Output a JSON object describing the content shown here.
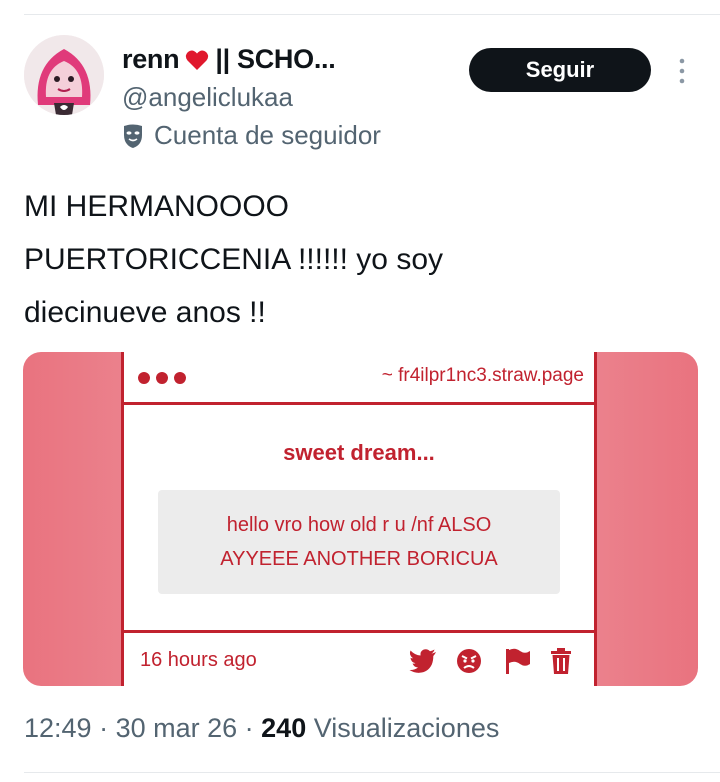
{
  "user": {
    "name": "renn",
    "name_suffix": "|| SCHO...",
    "handle": "@angeliclukaa",
    "follower_label": "Cuenta de seguidor",
    "follow_label": "Seguir"
  },
  "tweet": {
    "text": "MI HERMANOOOO\nPUERTORICCENIA !!!!!! yo soy\ndiecinueve anos !!"
  },
  "card": {
    "url": "~ fr4ilpr1nc3.straw.page",
    "headline": "sweet dream...",
    "message_line1": "hello vro how old r u /nf ALSO",
    "message_line2": "AYYEEE ANOTHER BORICUA",
    "time_ago": "16 hours ago",
    "accent": "#c1222f"
  },
  "meta": {
    "time": "12:49",
    "date": "30 mar 26",
    "views_count": "240",
    "views_label": "Visualizaciones"
  }
}
